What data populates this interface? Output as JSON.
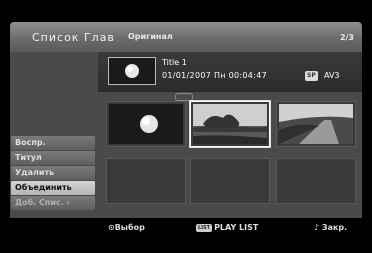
{
  "header": {
    "title": "Список Глав",
    "subtitle": "Оригинал",
    "page": "2/3"
  },
  "info": {
    "title": "Title 1",
    "datetime": "01/01/2007 Пн 00:04:47",
    "quality_badge": "SP",
    "input": "AV3"
  },
  "menu": {
    "items": [
      {
        "label": "Воспр."
      },
      {
        "label": "Титул"
      },
      {
        "label": "Удалить"
      },
      {
        "label": "Объединить"
      },
      {
        "label": "Доб. Спис. ›"
      }
    ]
  },
  "footer": {
    "select": "⊙Выбор",
    "list_badge": "LIST",
    "playlist": "PLAY LIST",
    "close": "♪ Закр."
  },
  "colors": {
    "header": "#7a7a7a",
    "panel": "#4a4a4a",
    "active_menu": "#c8c8c8"
  }
}
